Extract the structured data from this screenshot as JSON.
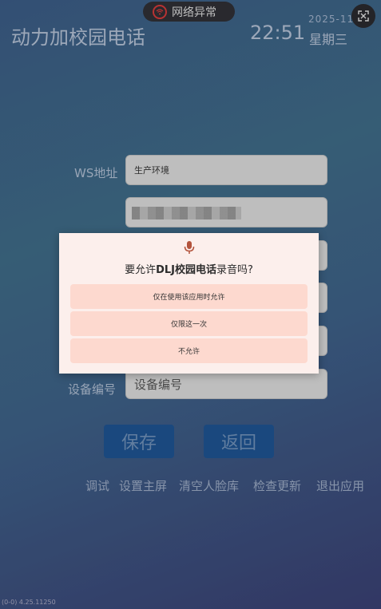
{
  "status": {
    "network_label": "网络异常"
  },
  "header": {
    "app_title": "动力加校园电话",
    "time": "22:51",
    "date": "2025-11",
    "weekday": "星期三"
  },
  "form": {
    "ws_label": "WS地址",
    "ws_value": "生产环境",
    "device_label": "设备编号",
    "device_placeholder": "设备编号"
  },
  "buttons": {
    "save": "保存",
    "back": "返回"
  },
  "links": [
    "调试",
    "设置主屏",
    "清空人脸库",
    "检查更新",
    "退出应用"
  ],
  "footer": {
    "version": "(0-0) 4.25.11250"
  },
  "dialog": {
    "title_prefix": "要允许",
    "title_app": "DLJ校园电话",
    "title_suffix": "录音吗?",
    "options": [
      "仅在使用该应用时允许",
      "仅限这一次",
      "不允许"
    ]
  },
  "icons": {
    "network": "wifi-error-icon",
    "close": "close-icon",
    "mic": "microphone-icon"
  },
  "colors": {
    "accent": "#1e5390",
    "dialog_option": "#fdd9cf",
    "mic": "#b3533c"
  }
}
